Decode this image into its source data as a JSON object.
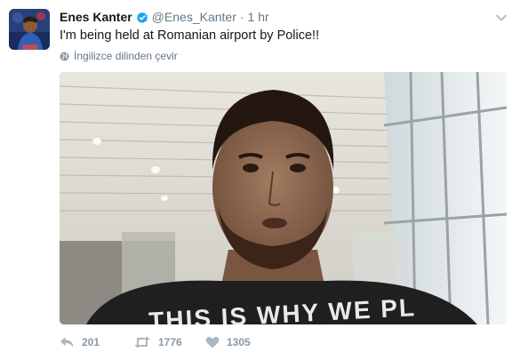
{
  "tweet": {
    "author_name": "Enes Kanter",
    "author_handle": "@Enes_Kanter",
    "time_separator": "·",
    "time": "1 hr",
    "text": "I'm being held at Romanian airport by Police!!",
    "translate_label": "İngilizce dilinden çevir",
    "media_overlay_text": "THIS IS WHY WE PL"
  },
  "actions": {
    "replies": "201",
    "retweets": "1776",
    "likes": "1305"
  },
  "icons": {
    "verified": "verified-badge-icon",
    "caret": "chevron-down-icon",
    "translate": "globe-icon",
    "reply": "reply-icon",
    "retweet": "retweet-icon",
    "like": "heart-icon"
  },
  "colors": {
    "verified": "#1da1f2",
    "meta_text": "#657786",
    "action_icon": "#aab8c2"
  }
}
